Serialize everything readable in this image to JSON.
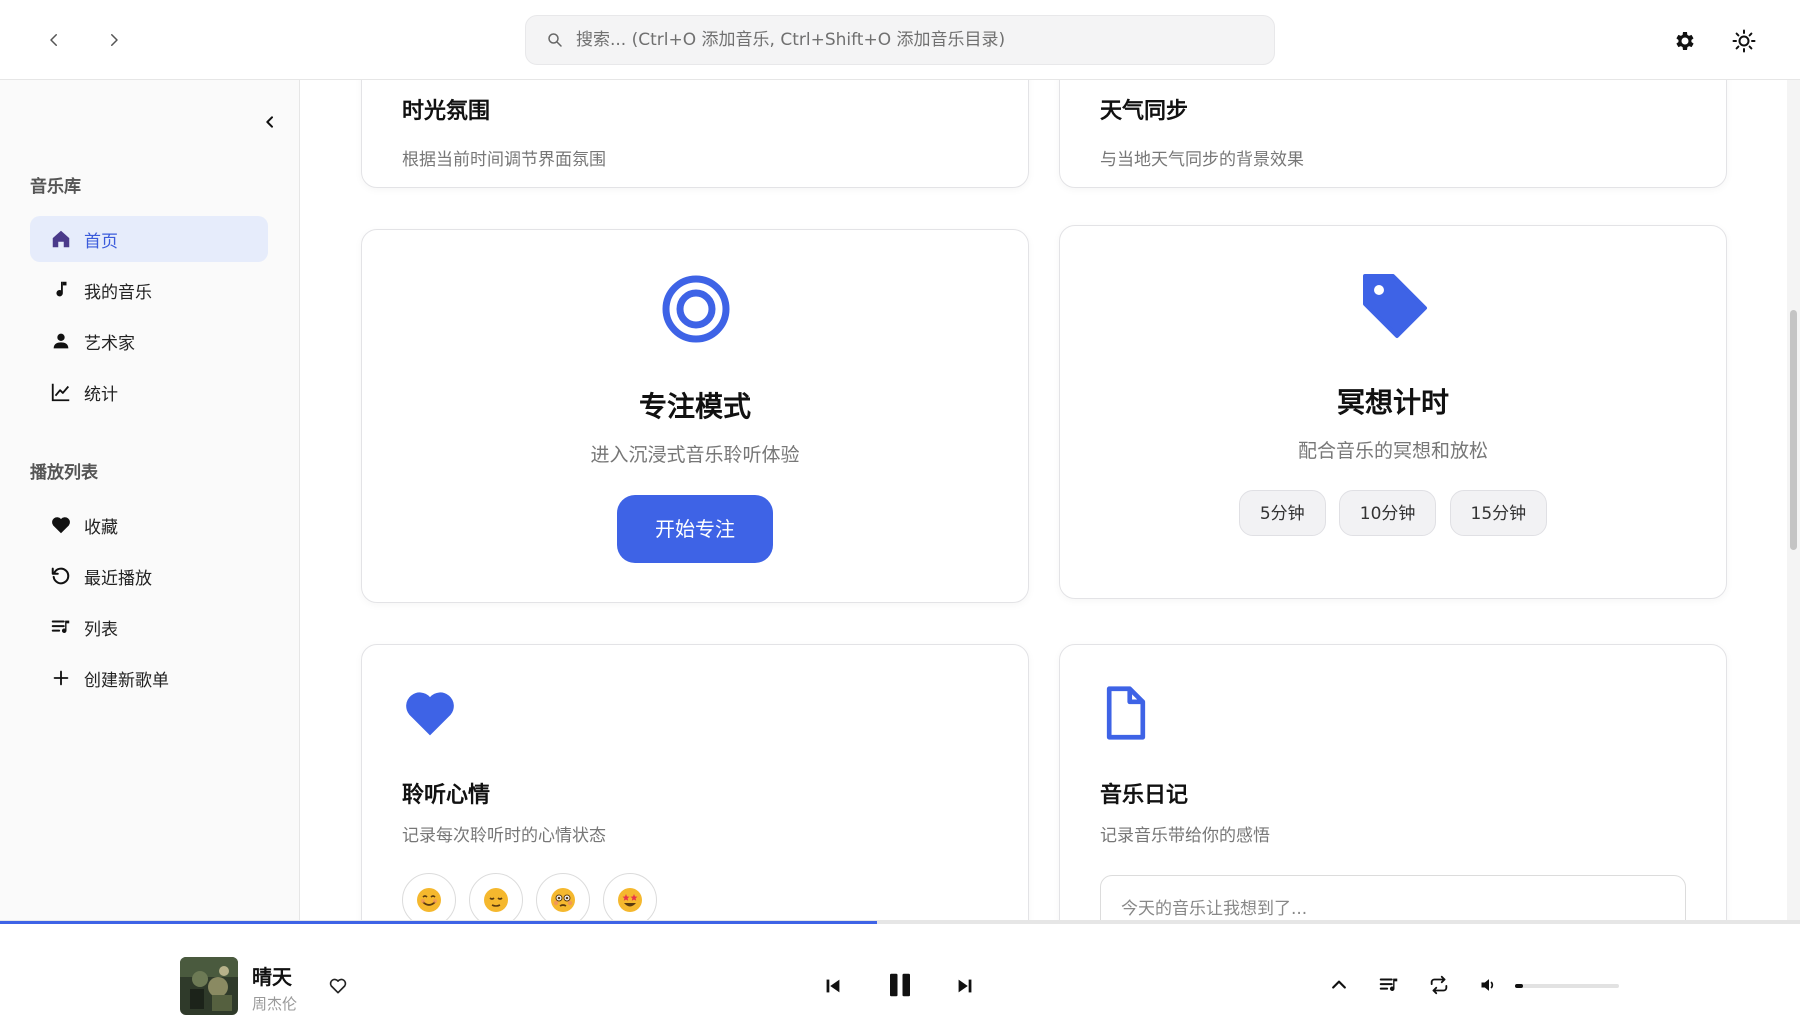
{
  "colors": {
    "accent": "#3e63e6",
    "active_bg": "#e6ecfb"
  },
  "search": {
    "placeholder": "搜索... (Ctrl+O 添加音乐, Ctrl+Shift+O 添加音乐目录)"
  },
  "sidebar": {
    "library_title": "音乐库",
    "library_items": [
      {
        "label": "首页",
        "icon": "home-icon",
        "active": true
      },
      {
        "label": "我的音乐",
        "icon": "music-note-icon"
      },
      {
        "label": "艺术家",
        "icon": "user-icon"
      },
      {
        "label": "统计",
        "icon": "chart-icon"
      }
    ],
    "playlist_title": "播放列表",
    "playlist_items": [
      {
        "label": "收藏",
        "icon": "heart-icon"
      },
      {
        "label": "最近播放",
        "icon": "history-icon"
      },
      {
        "label": "列表",
        "icon": "playlist-icon"
      },
      {
        "label": "创建新歌单",
        "icon": "plus-icon"
      }
    ]
  },
  "cards": {
    "ambience": {
      "title": "时光氛围",
      "desc": "根据当前时间调节界面氛围"
    },
    "weather": {
      "title": "天气同步",
      "desc": "与当地天气同步的背景效果"
    },
    "focus": {
      "title": "专注模式",
      "desc": "进入沉浸式音乐聆听体验",
      "button": "开始专注",
      "icon": "target-icon"
    },
    "meditation": {
      "title": "冥想计时",
      "desc": "配合音乐的冥想和放松",
      "options": [
        "5分钟",
        "10分钟",
        "15分钟"
      ],
      "icon": "tag-icon"
    },
    "mood": {
      "title": "聆听心情",
      "desc": "记录每次聆听时的心情状态",
      "icon": "heart-icon",
      "emojis": [
        "smiling-face",
        "relieved-face",
        "flushed-face",
        "star-struck-face"
      ]
    },
    "diary": {
      "title": "音乐日记",
      "desc": "记录音乐带给你的感悟",
      "placeholder": "今天的音乐让我想到了...",
      "icon": "document-icon"
    }
  },
  "player": {
    "title": "晴天",
    "artist": "周杰伦",
    "progress": 0.487,
    "volume": 0.08,
    "state": "playing"
  }
}
